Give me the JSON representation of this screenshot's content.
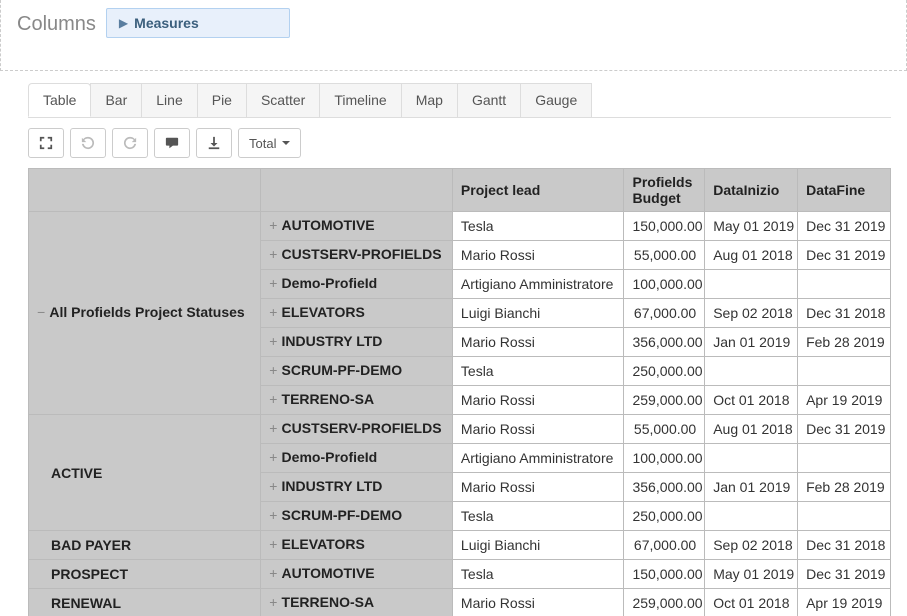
{
  "columns_area": {
    "label": "Columns",
    "chip": "Measures"
  },
  "tabs": [
    {
      "label": "Table",
      "active": true
    },
    {
      "label": "Bar",
      "active": false
    },
    {
      "label": "Line",
      "active": false
    },
    {
      "label": "Pie",
      "active": false
    },
    {
      "label": "Scatter",
      "active": false
    },
    {
      "label": "Timeline",
      "active": false
    },
    {
      "label": "Map",
      "active": false
    },
    {
      "label": "Gantt",
      "active": false
    },
    {
      "label": "Gauge",
      "active": false
    }
  ],
  "toolbar": {
    "total_label": "Total"
  },
  "headers": {
    "col1": "",
    "col2": "",
    "lead": "Project lead",
    "budget": "Profields Budget",
    "d1": "DataInizio",
    "d2": "DataFine"
  },
  "rows": [
    {
      "s_exp": "−",
      "status": "All Profields Project Statuses",
      "s_rowspan": 7,
      "p_exp": "+",
      "project": "AUTOMOTIVE",
      "lead": "Tesla",
      "budget": "150,000.00",
      "d1": "May 01 2019",
      "d2": "Dec 31 2019"
    },
    {
      "p_exp": "+",
      "project": "CUSTSERV-PROFIELDS",
      "lead": "Mario Rossi",
      "budget": "55,000.00",
      "d1": "Aug 01 2018",
      "d2": "Dec 31 2019"
    },
    {
      "p_exp": "+",
      "project": "Demo-ProfieId",
      "lead": "Artigiano Amministratore",
      "budget": "100,000.00",
      "d1": "",
      "d2": ""
    },
    {
      "p_exp": "+",
      "project": "ELEVATORS",
      "lead": "Luigi Bianchi",
      "budget": "67,000.00",
      "d1": "Sep 02 2018",
      "d2": "Dec 31 2018"
    },
    {
      "p_exp": "+",
      "project": "INDUSTRY LTD",
      "lead": "Mario Rossi",
      "budget": "356,000.00",
      "d1": "Jan 01 2019",
      "d2": "Feb 28 2019"
    },
    {
      "p_exp": "+",
      "project": "SCRUM-PF-DEMO",
      "lead": "Tesla",
      "budget": "250,000.00",
      "d1": "",
      "d2": ""
    },
    {
      "p_exp": "+",
      "project": "TERRENO-SA",
      "lead": "Mario Rossi",
      "budget": "259,000.00",
      "d1": "Oct 01 2018",
      "d2": "Apr 19 2019"
    },
    {
      "status": "ACTIVE",
      "s_indent": true,
      "s_rowspan": 4,
      "p_exp": "+",
      "project": "CUSTSERV-PROFIELDS",
      "lead": "Mario Rossi",
      "budget": "55,000.00",
      "d1": "Aug 01 2018",
      "d2": "Dec 31 2019"
    },
    {
      "p_exp": "+",
      "project": "Demo-ProfieId",
      "lead": "Artigiano Amministratore",
      "budget": "100,000.00",
      "d1": "",
      "d2": ""
    },
    {
      "p_exp": "+",
      "project": "INDUSTRY LTD",
      "lead": "Mario Rossi",
      "budget": "356,000.00",
      "d1": "Jan 01 2019",
      "d2": "Feb 28 2019"
    },
    {
      "p_exp": "+",
      "project": "SCRUM-PF-DEMO",
      "lead": "Tesla",
      "budget": "250,000.00",
      "d1": "",
      "d2": ""
    },
    {
      "status": "BAD PAYER",
      "s_indent": true,
      "s_rowspan": 1,
      "p_exp": "+",
      "project": "ELEVATORS",
      "lead": "Luigi Bianchi",
      "budget": "67,000.00",
      "d1": "Sep 02 2018",
      "d2": "Dec 31 2018"
    },
    {
      "status": "PROSPECT",
      "s_indent": true,
      "s_rowspan": 1,
      "p_exp": "+",
      "project": "AUTOMOTIVE",
      "lead": "Tesla",
      "budget": "150,000.00",
      "d1": "May 01 2019",
      "d2": "Dec 31 2019"
    },
    {
      "status": "RENEWAL",
      "s_indent": true,
      "s_rowspan": 1,
      "p_exp": "+",
      "project": "TERRENO-SA",
      "lead": "Mario Rossi",
      "budget": "259,000.00",
      "d1": "Oct 01 2018",
      "d2": "Apr 19 2019"
    }
  ]
}
